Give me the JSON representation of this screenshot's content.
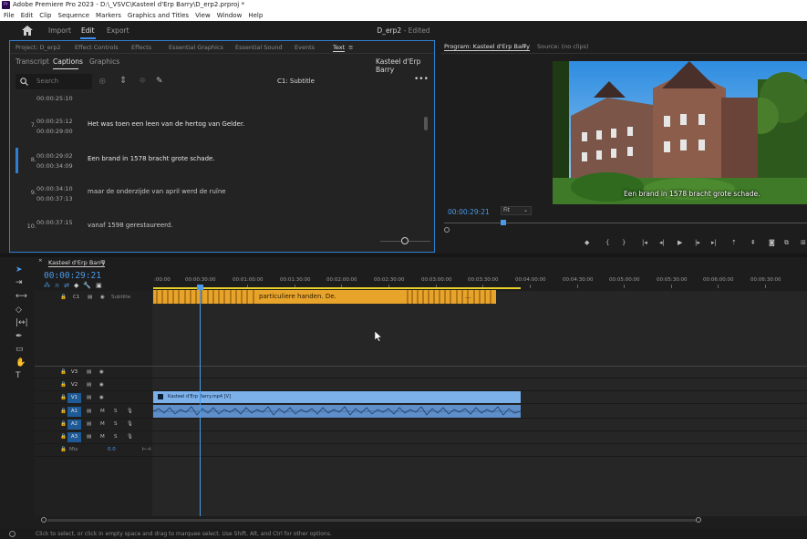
{
  "window": {
    "title": "Adobe Premiere Pro 2023 - D:\\_VSVC\\Kasteel d'Erp Barry\\D_erp2.prproj *",
    "app_icon": "Pr"
  },
  "menu": [
    "File",
    "Edit",
    "Clip",
    "Sequence",
    "Markers",
    "Graphics and Titles",
    "View",
    "Window",
    "Help"
  ],
  "workspace": {
    "tabs": [
      "Import",
      "Edit",
      "Export"
    ],
    "active_tab": "Edit",
    "document_title": "D_erp2",
    "document_status": "- Edited"
  },
  "text_panel": {
    "tabs": [
      "Project: D_erp2",
      "Effect Controls",
      "Effects",
      "Essential Graphics",
      "Essential Sound",
      "Events",
      "Text"
    ],
    "active_tab": "Text",
    "subtabs": [
      "Transcript",
      "Captions",
      "Graphics"
    ],
    "active_subtab": "Captions",
    "sequence_name": "Kasteel d'Erp Barry",
    "search_placeholder": "Search",
    "track_label": "C1: Subtitle",
    "first_timecode": "00:00:25:10",
    "captions": [
      {
        "num": "7.",
        "in": "00:00:25:12",
        "out": "00:00:29:00",
        "text": "Het was toen een leen van de hertog van Gelder.",
        "selected": false
      },
      {
        "num": "8.",
        "in": "00:00:29:02",
        "out": "00:00:34:09",
        "text": "Een brand in 1578 bracht grote schade.",
        "selected": true
      },
      {
        "num": "9.",
        "in": "00:00:34:10",
        "out": "00:00:37:13",
        "text": "maar de onderzijde van april werd de ruïne",
        "selected": false
      },
      {
        "num": "10.",
        "in": "00:00:37:15",
        "out": "",
        "text": "vanaf 1598 gerestaureerd.",
        "selected": false
      }
    ]
  },
  "program_monitor": {
    "tabs": [
      "Program: Kasteel d'Erp Barry",
      "Source: (no clips)"
    ],
    "timecode": "00:00:29:21",
    "zoom": "Fit",
    "caption_overlay": "Een brand in 1578 bracht grote schade."
  },
  "timeline": {
    "sequence_tab": "Kasteel d'Erp Barry",
    "timecode": "00:00:29:21",
    "ruler_labels": [
      ":00:00",
      "00:00:30:00",
      "00:01:00:00",
      "00:01:30:00",
      "00:02:00:00",
      "00:02:30:00",
      "00:03:00:00",
      "00:03:30:00",
      "00:04:00:00",
      "00:04:30:00",
      "00:05:00:00",
      "00:05:30:00",
      "00:06:00:00",
      "00:06:30:00"
    ],
    "caption_track": {
      "label": "C1",
      "name": "Subtitle",
      "clip_text": "particuliere handen. De.",
      "clip_text_2": "..."
    },
    "video_tracks": [
      "V3",
      "V2",
      "V1"
    ],
    "audio_tracks": [
      "A1",
      "A2",
      "A3"
    ],
    "mix_label": "Mix",
    "mix_value": "0.0",
    "video_clip_name": "Kasteel d'Erp Barry.mp4 [V]",
    "track_buttons": {
      "mute": "M",
      "solo": "S"
    }
  },
  "status_bar": "Click to select, or click in empty space and drag to marquee select. Use Shift, Alt, and Ctrl for other options.",
  "colors": {
    "accent_blue": "#2f7fd0",
    "timecode_blue": "#4a9ae8",
    "caption_clip": "#e8a42a",
    "video_clip": "#7cb0e8",
    "audio_clip": "#5f8fca"
  }
}
